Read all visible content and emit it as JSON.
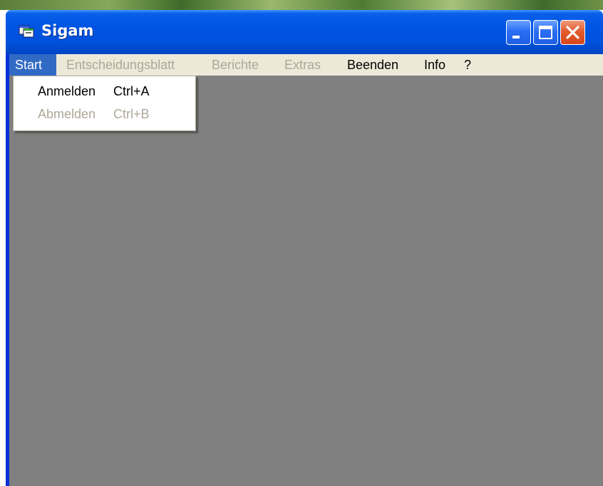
{
  "window": {
    "title": "Sigam",
    "title_color": "#ffffff",
    "titlebar_color": "#0054e3"
  },
  "menubar": {
    "items": [
      {
        "label": "Start",
        "state": "active"
      },
      {
        "label": "Entscheidungsblatt",
        "state": "disabled"
      },
      {
        "label": "Berichte",
        "state": "disabled"
      },
      {
        "label": "Extras",
        "state": "disabled"
      },
      {
        "label": "Beenden",
        "state": "enabled"
      },
      {
        "label": "Info",
        "state": "enabled"
      },
      {
        "label": "?",
        "state": "enabled"
      }
    ]
  },
  "start_menu": {
    "items": [
      {
        "label": "Anmelden",
        "shortcut": "Ctrl+A",
        "state": "enabled"
      },
      {
        "label": "Abmelden",
        "shortcut": "Ctrl+B",
        "state": "disabled"
      }
    ]
  },
  "colors": {
    "menu_highlight": "#316ac5",
    "disabled_text": "#aca899",
    "client_background": "#808080",
    "close_button": "#d8461c"
  },
  "icons": {
    "app": "app-window-icon",
    "minimize": "minimize-icon",
    "maximize": "maximize-icon",
    "close": "close-icon"
  }
}
